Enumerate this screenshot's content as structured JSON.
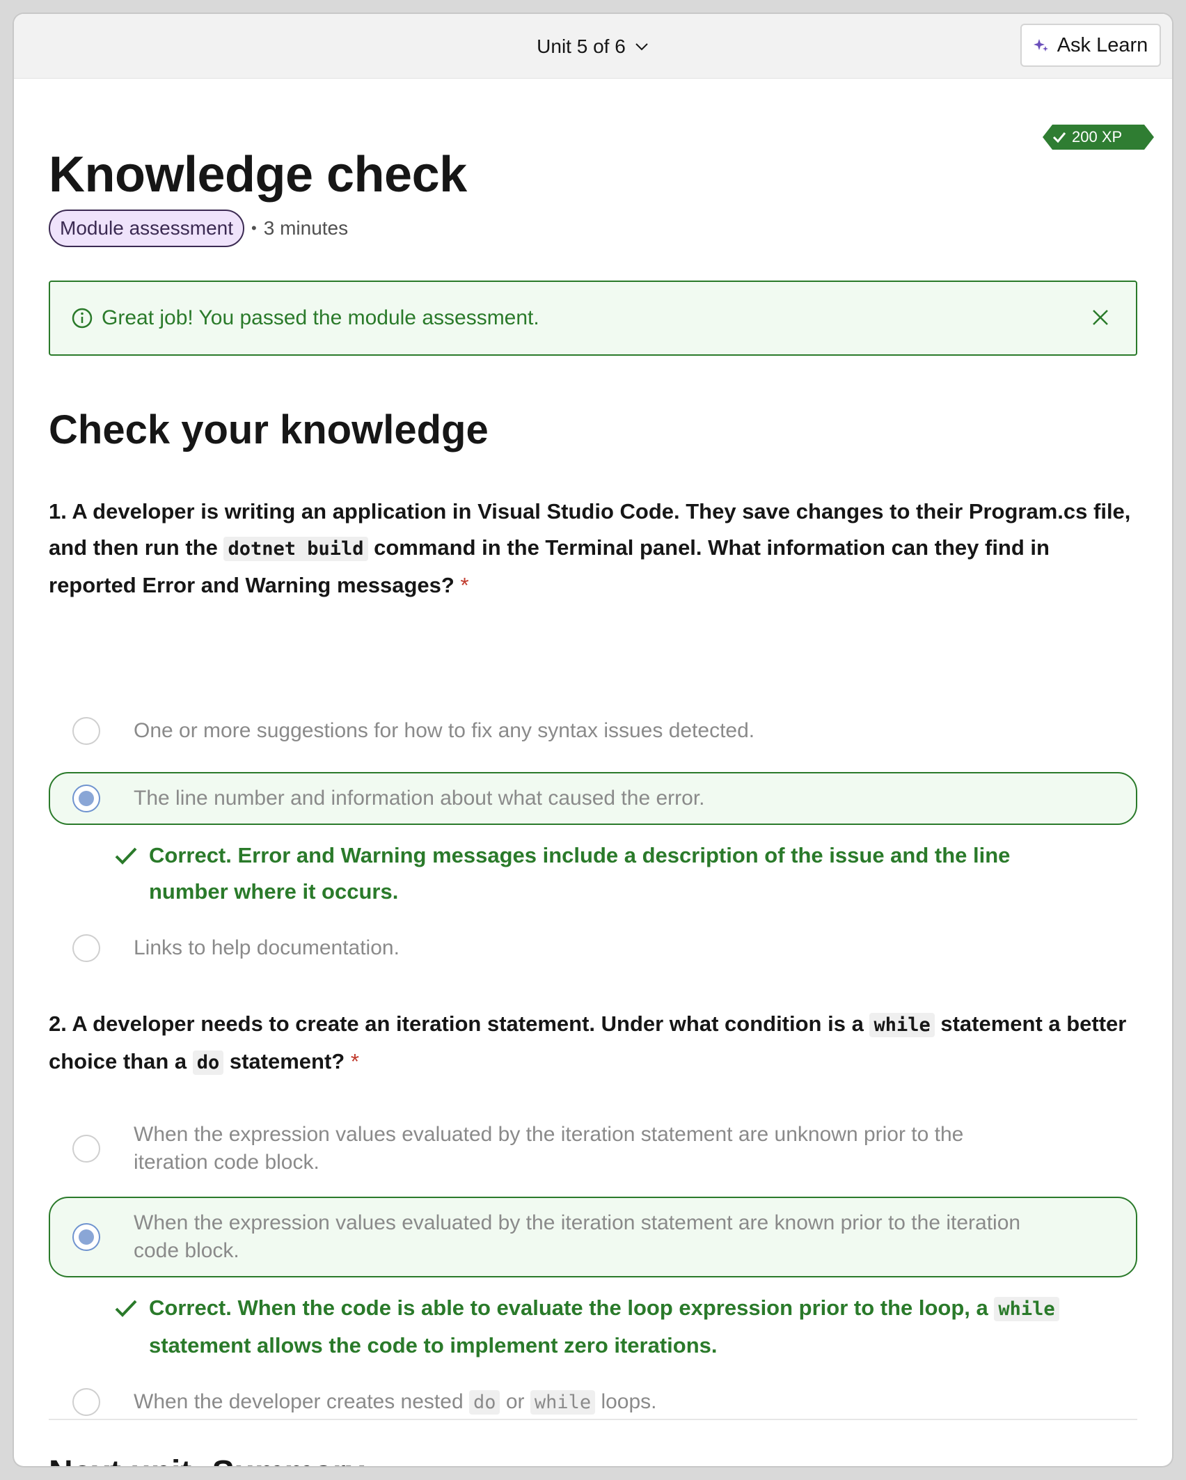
{
  "topbar": {
    "unit_label": "Unit 5 of 6",
    "ask_learn_label": "Ask Learn"
  },
  "page": {
    "xp": "200 XP",
    "title": "Knowledge check",
    "badge": "Module assessment",
    "separator": "•",
    "duration": "3 minutes"
  },
  "alert": {
    "message": "Great job! You passed the module assessment."
  },
  "section_title": "Check your knowledge",
  "questions": [
    {
      "text_before": "1. A developer is writing an application in Visual Studio Code. They save changes to their Program.cs file, and then run the ",
      "code": "dotnet build",
      "text_after": " command in the Terminal panel. What information can they find in reported Error and Warning messages?",
      "required": "*",
      "options": [
        "One or more suggestions for how to fix any syntax issues detected.",
        "The line number and information about what caused the error.",
        "Links to help documentation."
      ],
      "selected_index": 1,
      "feedback": "Correct. Error and Warning messages include a description of the issue and the line number where it occurs."
    },
    {
      "text_a": "2. A developer needs to create an iteration statement. Under what condition is a ",
      "code_a": "while",
      "text_b": " statement a better choice than a ",
      "code_b": "do",
      "text_c": " statement?",
      "required": "*",
      "options": [
        "When the expression values evaluated by the iteration statement are unknown prior to the iteration code block.",
        "When the expression values evaluated by the iteration statement are known prior to the iteration code block."
      ],
      "option4": {
        "text_a": "When the developer creates nested ",
        "code_a": "do",
        "text_b": " or ",
        "code_b": "while",
        "text_c": " loops."
      },
      "selected_index": 1,
      "feedback_a": "Correct. When the code is able to evaluate the loop expression prior to the loop, a ",
      "feedback_code": "while",
      "feedback_b": " statement allows the code to implement zero iterations."
    }
  ],
  "next_unit": "Next unit: Summary",
  "colors": {
    "success": "#2a7a2a",
    "success_bg": "#f1faf1",
    "badge_bg": "#efe3fb",
    "badge_border": "#3b2a52",
    "xp_bg": "#2f7d32"
  }
}
